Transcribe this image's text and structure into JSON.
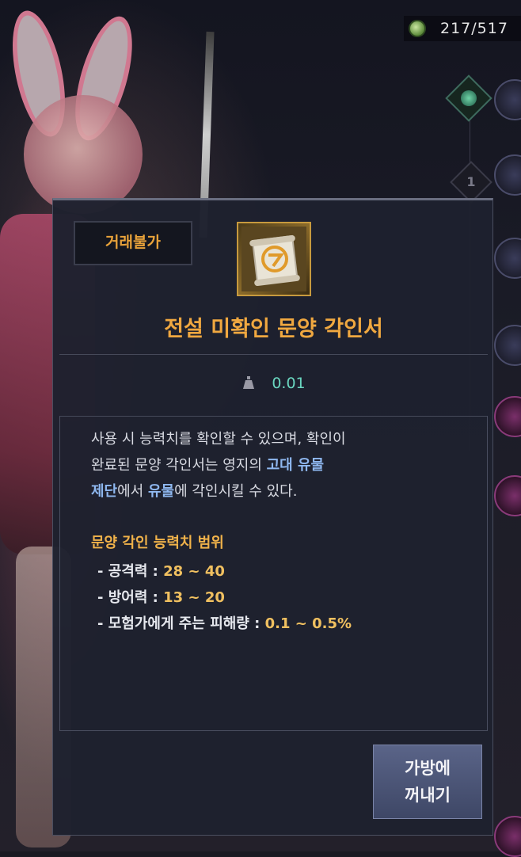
{
  "top_counter": {
    "icon": "green-coin-icon",
    "text": "217/517"
  },
  "background": {
    "skill_badges": [
      "1"
    ]
  },
  "tooltip": {
    "trade_badge": "거래불가",
    "item_icon": "golden-scroll-icon",
    "title": "전설 미확인 문양 각인서",
    "weight_icon": "weight-icon",
    "weight": "0.01",
    "description": {
      "line1": "사용 시 능력치를 확인할 수 있으며, 확인이",
      "line2_a": "완료된 문양 각인서는 영지의 ",
      "line2_b": "고대 유물",
      "line3_a": "제단",
      "line3_b": "에서 ",
      "line3_c": "유물",
      "line3_d": "에 각인시킬 수 있다."
    },
    "range_title": "문양 각인 능력치 범위",
    "ranges": [
      {
        "label": "- 공격력 : ",
        "value": "28 ~ 40"
      },
      {
        "label": "- 방어력 : ",
        "value": "13 ~ 20"
      },
      {
        "label": "- 모험가에게 주는 피해량 : ",
        "value": "0.1 ~ 0.5%"
      }
    ]
  },
  "action_button": {
    "line1": "가방에",
    "line2": "꺼내기"
  },
  "colors": {
    "title": "#f0a840",
    "trade_badge": "#e8a23a",
    "weight": "#6ad6c0",
    "highlight": "#8fb8f0",
    "range_value": "#f0c060"
  }
}
